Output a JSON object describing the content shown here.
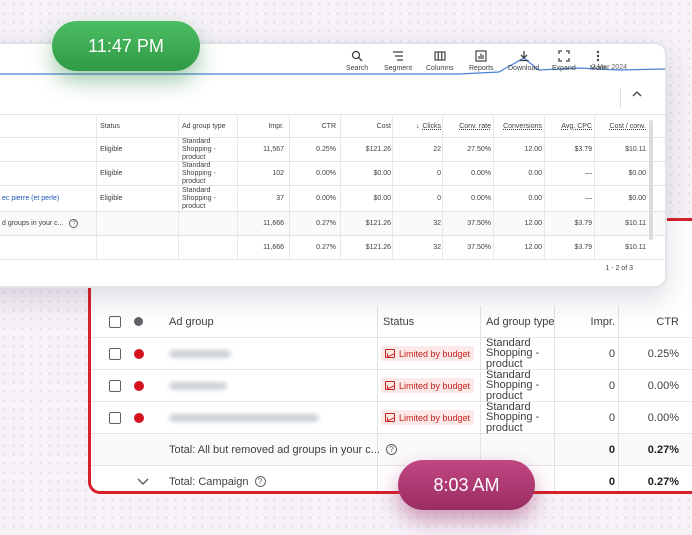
{
  "pills": {
    "front_time": "11:47 PM",
    "back_time": "8:03 AM",
    "front_color": "#3aa854",
    "back_color": "#b03a73"
  },
  "front": {
    "chart_date": "2 Mar 2024",
    "toolbar": [
      {
        "label": "Search",
        "icon": "search-icon"
      },
      {
        "label": "Segment",
        "icon": "segment-icon"
      },
      {
        "label": "Columns",
        "icon": "columns-icon"
      },
      {
        "label": "Reports",
        "icon": "reports-icon"
      },
      {
        "label": "Download",
        "icon": "download-icon"
      },
      {
        "label": "Expand",
        "icon": "expand-icon"
      },
      {
        "label": "More",
        "icon": "more-icon"
      }
    ],
    "headers": {
      "status": "Status",
      "ad_group_type": "Ad group type",
      "impr": "Impr.",
      "ctr": "CTR",
      "cost": "Cost",
      "clicks": "Clicks",
      "conv_rate": "Conv. rate",
      "conversions": "Conversions",
      "avg_cpc": "Avg. CPC",
      "cost_conv": "Cost / conv."
    },
    "rows": [
      {
        "name": "",
        "status": "Eligible",
        "type": [
          "Standard",
          "Shopping -",
          "product"
        ],
        "impr": "11,567",
        "ctr": "0.25%",
        "cost": "$121.26",
        "clicks": "22",
        "conv_rate": "27.50%",
        "conversions": "12.00",
        "avg_cpc": "$3.79",
        "cost_conv": "$10.11"
      },
      {
        "name": "",
        "status": "Eligible",
        "type": [
          "Standard",
          "Shopping -",
          "product"
        ],
        "impr": "102",
        "ctr": "0.00%",
        "cost": "$0.00",
        "clicks": "0",
        "conv_rate": "0.00%",
        "conversions": "0.00",
        "avg_cpc": "—",
        "cost_conv": "$0.00"
      },
      {
        "name": "ec pierre (et perle)",
        "status": "Eligible",
        "type": [
          "Standard",
          "Shopping -",
          "product"
        ],
        "impr": "37",
        "ctr": "0.00%",
        "cost": "$0.00",
        "clicks": "0",
        "conv_rate": "0.00%",
        "conversions": "0.00",
        "avg_cpc": "—",
        "cost_conv": "$0.00"
      }
    ],
    "total_all": {
      "name": "d groups in your c...",
      "impr": "11,666",
      "ctr": "0.27%",
      "cost": "$121.26",
      "clicks": "32",
      "conv_rate": "37.50%",
      "conversions": "12.00",
      "avg_cpc": "$3.79",
      "cost_conv": "$10.11"
    },
    "total_campaign": {
      "impr": "11,666",
      "ctr": "0.27%",
      "cost": "$121.26",
      "clicks": "32",
      "conv_rate": "37.50%",
      "conversions": "12.00",
      "avg_cpc": "$3.79",
      "cost_conv": "$10.11"
    },
    "pagination": "1 - 2 of 3"
  },
  "back": {
    "headers": {
      "ad_group": "Ad group",
      "status": "Status",
      "ad_group_type": "Ad group type",
      "impr": "Impr.",
      "ctr": "CTR"
    },
    "rows": [
      {
        "status": "Limited by budget",
        "type": [
          "Standard",
          "Shopping -",
          "product"
        ],
        "impr": "0",
        "ctr": "0.25%"
      },
      {
        "status": "Limited by budget",
        "type": [
          "Standard",
          "Shopping -",
          "product"
        ],
        "impr": "0",
        "ctr": "0.00%"
      },
      {
        "status": "Limited by budget",
        "type": [
          "Standard",
          "Shopping -",
          "product"
        ],
        "impr": "0",
        "ctr": "0.00%"
      }
    ],
    "total_all": {
      "label": "Total: All but removed ad groups in your c...",
      "impr": "0",
      "ctr": "0.27%"
    },
    "total_campaign": {
      "label": "Total: Campaign",
      "impr": "0",
      "ctr": "0.27%"
    }
  }
}
